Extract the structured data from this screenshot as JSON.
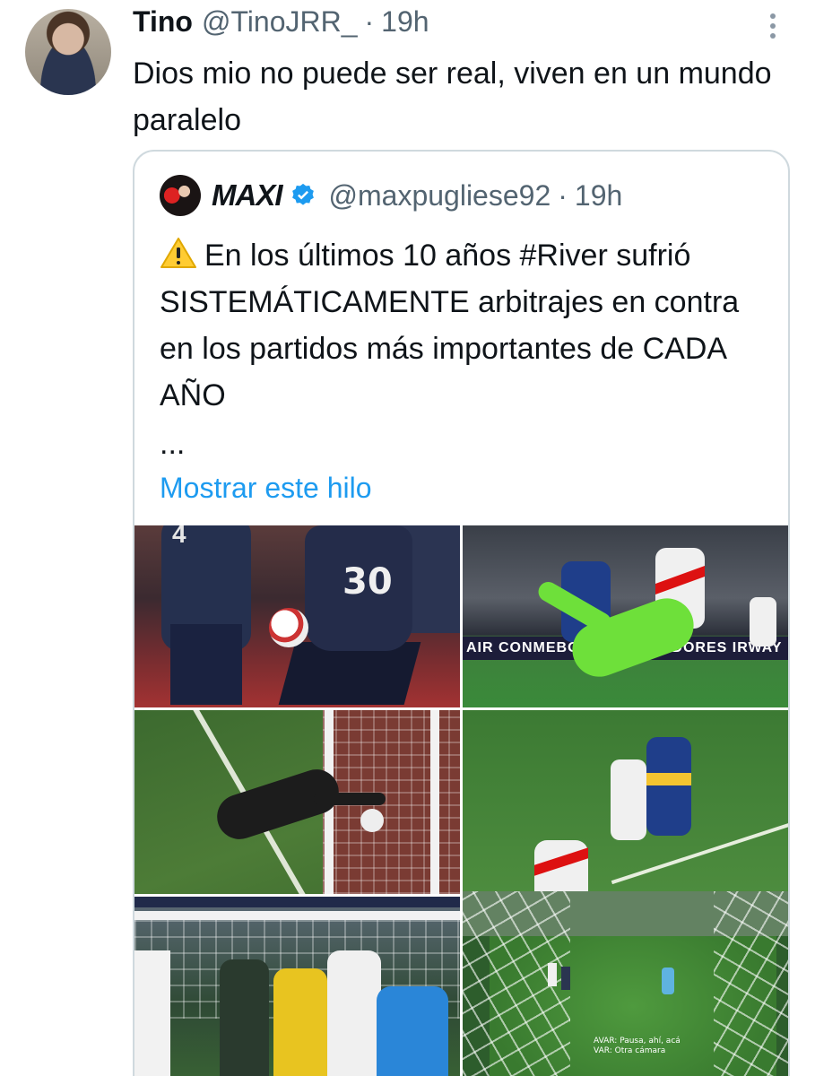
{
  "tweet": {
    "author_name": "Tino",
    "author_handle": "@TinoJRR_",
    "separator": "·",
    "time": "19h",
    "text": "Dios mio no puede ser real, viven en un mundo paralelo"
  },
  "quote": {
    "author_name": "MAXI",
    "author_handle": "@maxpugliese92",
    "separator": "·",
    "time": "19h",
    "text": "En los últimos 10 años #River sufrió SISTEMÁTICAMENTE arbitrajes en contra en los partidos más importantes de CADA AÑO",
    "ellipsis": "...",
    "show_thread": "Mostrar este hilo",
    "media": {
      "board_text": "AIR  CONMEBOL  ·  LIBERTADORES  IRWAY",
      "number_30": "30",
      "number_4": "4",
      "var_caption_1": "AVAR: Pausa, ahí, acá",
      "var_caption_2": "VAR: Otra cámara"
    }
  },
  "colors": {
    "link": "#1d9bf0",
    "secondary_text": "#536471",
    "verified": "#1d9bf0",
    "warning": "#ffcc33"
  },
  "icons": {
    "more": "more-vertical-icon",
    "verified": "verified-badge-icon",
    "warning": "warning-icon"
  }
}
